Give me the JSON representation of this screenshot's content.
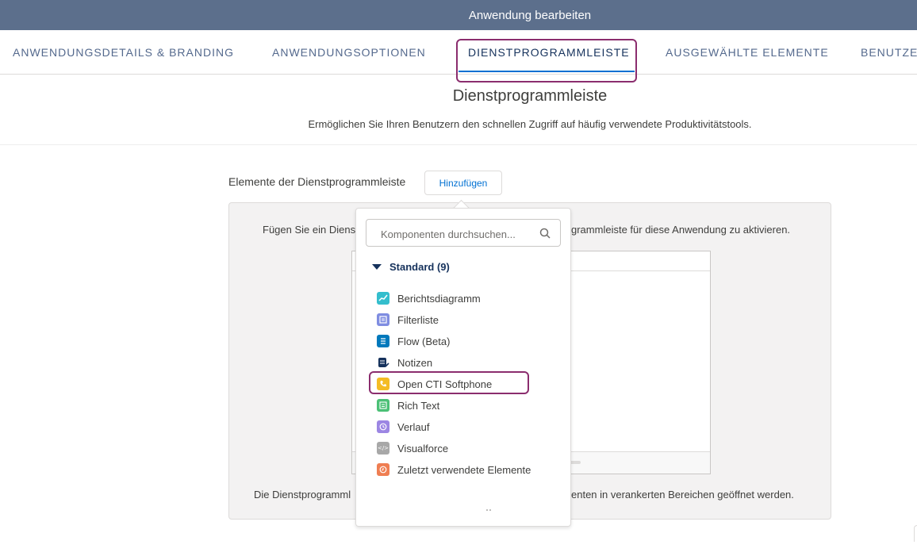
{
  "window": {
    "title": "Anwendung bearbeiten"
  },
  "tabs": [
    {
      "label": "ANWENDUNGSDETAILS & BRANDING"
    },
    {
      "label": "ANWENDUNGSOPTIONEN"
    },
    {
      "label": "DIENSTPROGRAMMLEISTE",
      "active": true
    },
    {
      "label": "AUSGEWÄHLTE ELEMENTE"
    },
    {
      "label": "BENUTZER"
    }
  ],
  "page": {
    "title": "Dienstprogrammleiste",
    "subtitle": "Ermöglichen Sie Ihren Benutzern den schnellen Zugriff auf häufig verwendete Produktivitätstools."
  },
  "utility": {
    "label": "Elemente der Dienstprogrammleiste",
    "add_label": "Hinzufügen",
    "panel_top_left": "Fügen Sie ein Diens",
    "panel_top_right": "grammleiste für diese Anwendung zu aktivieren.",
    "panel_bottom_left": "Die Dienstprogramml",
    "panel_bottom_right": "enten in verankerten Bereichen geöffnet werden."
  },
  "popover": {
    "search_placeholder": "Komponenten durchsuchen...",
    "section_label": "Standard (9)",
    "items": [
      {
        "label": "Berichtsdiagramm",
        "icon": "chart-icon",
        "color": "#34becd"
      },
      {
        "label": "Filterliste",
        "icon": "filter-list-icon",
        "color": "#7f8de1"
      },
      {
        "label": "Flow (Beta)",
        "icon": "flow-icon",
        "color": "#0079bc"
      },
      {
        "label": "Notizen",
        "icon": "notes-icon",
        "color": "#16325c"
      },
      {
        "label": "Open CTI Softphone",
        "icon": "phone-icon",
        "color": "#f4bc25"
      },
      {
        "label": "Rich Text",
        "icon": "rich-text-icon",
        "color": "#4bc076"
      },
      {
        "label": "Verlauf",
        "icon": "history-icon",
        "color": "#9c86e3"
      },
      {
        "label": "Visualforce",
        "icon": "visualforce-icon",
        "color": "#a8a8a8"
      },
      {
        "label": "Zuletzt verwendete Elemente",
        "icon": "recent-icon",
        "color": "#ef7e52"
      }
    ]
  },
  "colors": {
    "titlebar": "#5c6f8c",
    "accent": "#0070d2",
    "highlight": "#8b2d6e"
  }
}
